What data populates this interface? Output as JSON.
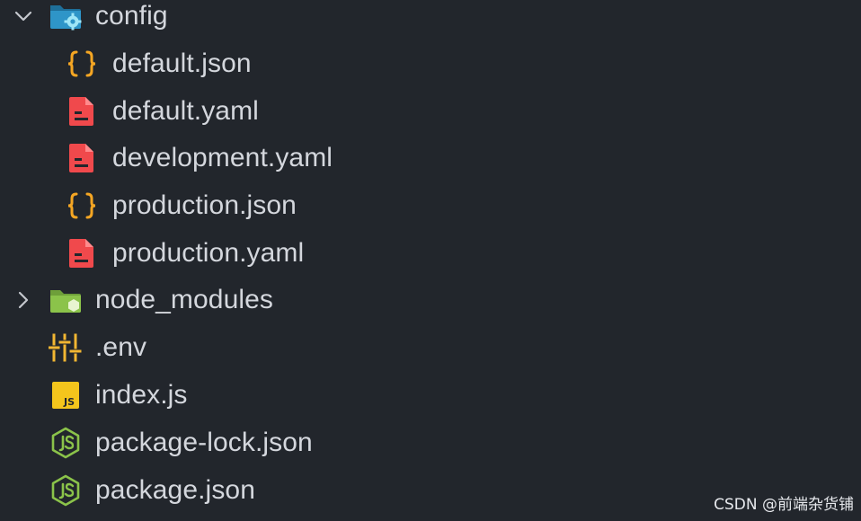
{
  "explorer": {
    "items": [
      {
        "label": "config",
        "type": "folder-config",
        "expanded": true,
        "icon": "folder-gear-icon"
      },
      {
        "label": "default.json",
        "type": "json",
        "icon": "braces-icon"
      },
      {
        "label": "default.yaml",
        "type": "yaml",
        "icon": "yaml-file-icon"
      },
      {
        "label": "development.yaml",
        "type": "yaml",
        "icon": "yaml-file-icon"
      },
      {
        "label": "production.json",
        "type": "json",
        "icon": "braces-icon"
      },
      {
        "label": "production.yaml",
        "type": "yaml",
        "icon": "yaml-file-icon"
      },
      {
        "label": "node_modules",
        "type": "folder-node",
        "expanded": false,
        "icon": "node-folder-icon"
      },
      {
        "label": ".env",
        "type": "env",
        "icon": "settings-sliders-icon"
      },
      {
        "label": "index.js",
        "type": "js",
        "icon": "javascript-icon"
      },
      {
        "label": "package-lock.json",
        "type": "npm",
        "icon": "nodejs-icon"
      },
      {
        "label": "package.json",
        "type": "npm",
        "icon": "nodejs-icon"
      }
    ]
  },
  "watermark": "CSDN @前端杂货铺",
  "colors": {
    "background": "#22262c",
    "text": "#d4d7dd",
    "json": "#f5a623",
    "yaml": "#f0494c",
    "folder_config": "#3aa0d4",
    "folder_node": "#8bc34a",
    "env": "#f2b632",
    "js": "#f4c51c",
    "node": "#8bc34a"
  }
}
